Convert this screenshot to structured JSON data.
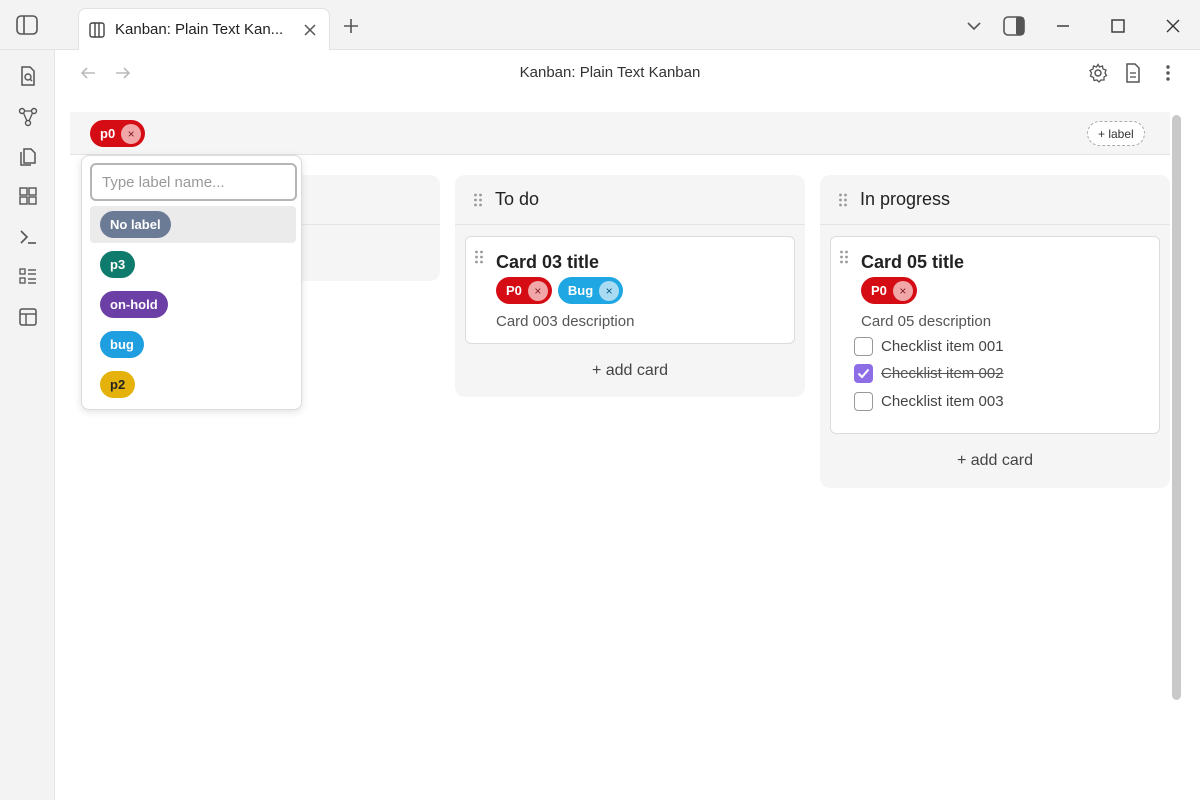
{
  "window": {
    "tab_title": "Kanban: Plain Text Kan...",
    "view_title": "Kanban: Plain Text Kanban"
  },
  "icons": {
    "sidebar_toggle": "sidebar-left-icon",
    "tab": "columns-icon",
    "tab_close": "close-icon",
    "new_tab": "plus-icon",
    "chevron": "chevron-down-icon",
    "right_sidebar": "sidebar-right-icon",
    "minimize": "minimize-icon",
    "maximize": "maximize-icon",
    "close": "close-icon",
    "back": "arrow-left-icon",
    "forward": "arrow-right-icon",
    "settings": "gear-icon",
    "doc": "document-icon",
    "more": "more-vertical-icon"
  },
  "ribbon": [
    "search-file-icon",
    "graph-icon",
    "files-icon",
    "blocks-icon",
    "terminal-icon",
    "list-icon",
    "layout-icon"
  ],
  "filter": {
    "active_label": "p0",
    "remove_symbol": "×",
    "add_label": "+ label"
  },
  "dropdown": {
    "placeholder": "Type label name...",
    "options": [
      {
        "label": "No label",
        "color": "#6b7b95"
      },
      {
        "label": "p3",
        "color": "#0f7b6c"
      },
      {
        "label": "on-hold",
        "color": "#6c3fa6"
      },
      {
        "label": "bug",
        "color": "#1f9ee0"
      },
      {
        "label": "p2",
        "color": "#e5b20c"
      }
    ]
  },
  "columns": [
    {
      "title": "To do",
      "cards": [
        {
          "title": "Card 03 title",
          "labels": [
            {
              "text": "P0",
              "color": "#d50c14"
            },
            {
              "text": "Bug",
              "color": "#1fa7e3"
            }
          ],
          "description": "Card 003 description"
        }
      ],
      "add_card": "+ add card"
    },
    {
      "title": "In progress",
      "cards": [
        {
          "title": "Card 05 title",
          "labels": [
            {
              "text": "P0",
              "color": "#d50c14"
            }
          ],
          "description": "Card 05 description",
          "checklist": [
            {
              "text": "Checklist item 001",
              "checked": false
            },
            {
              "text": "Checklist item 002",
              "checked": true
            },
            {
              "text": "Checklist item 003",
              "checked": false
            }
          ]
        }
      ],
      "add_card": "+ add card"
    }
  ],
  "colors": {
    "accent_check": "#8e6ee6",
    "p0": "#d50c14"
  }
}
